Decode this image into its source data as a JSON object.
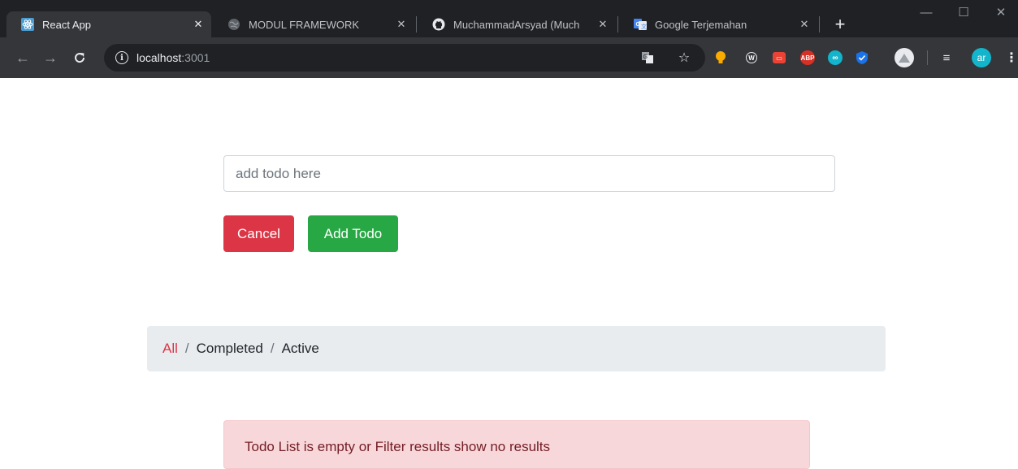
{
  "tabs": [
    {
      "title": "React App",
      "icon": "react-icon",
      "active": true
    },
    {
      "title": "MODUL FRAMEWORK",
      "icon": "globe-icon",
      "active": false
    },
    {
      "title": "MuchammadArsyad (Much",
      "icon": "github-icon",
      "active": false
    },
    {
      "title": "Google Terjemahan",
      "icon": "google-translate-icon",
      "active": false
    }
  ],
  "address_bar": {
    "host": "localhost",
    "port": ":3001"
  },
  "extensions": {
    "profile_initials": "ar",
    "abp_label": "ABP"
  },
  "todo_form": {
    "placeholder": "add todo here",
    "cancel_label": "Cancel",
    "add_label": "Add Todo"
  },
  "filters": {
    "items": [
      "All",
      "Completed",
      "Active"
    ],
    "separator": "/",
    "active": "All"
  },
  "alert": {
    "message": "Todo List is empty or Filter results show no results"
  },
  "colors": {
    "danger": "#dc3545",
    "success": "#28a745",
    "filter_bg": "#e9ecef",
    "alert_bg": "#f8d7da",
    "alert_text": "#721c24"
  }
}
